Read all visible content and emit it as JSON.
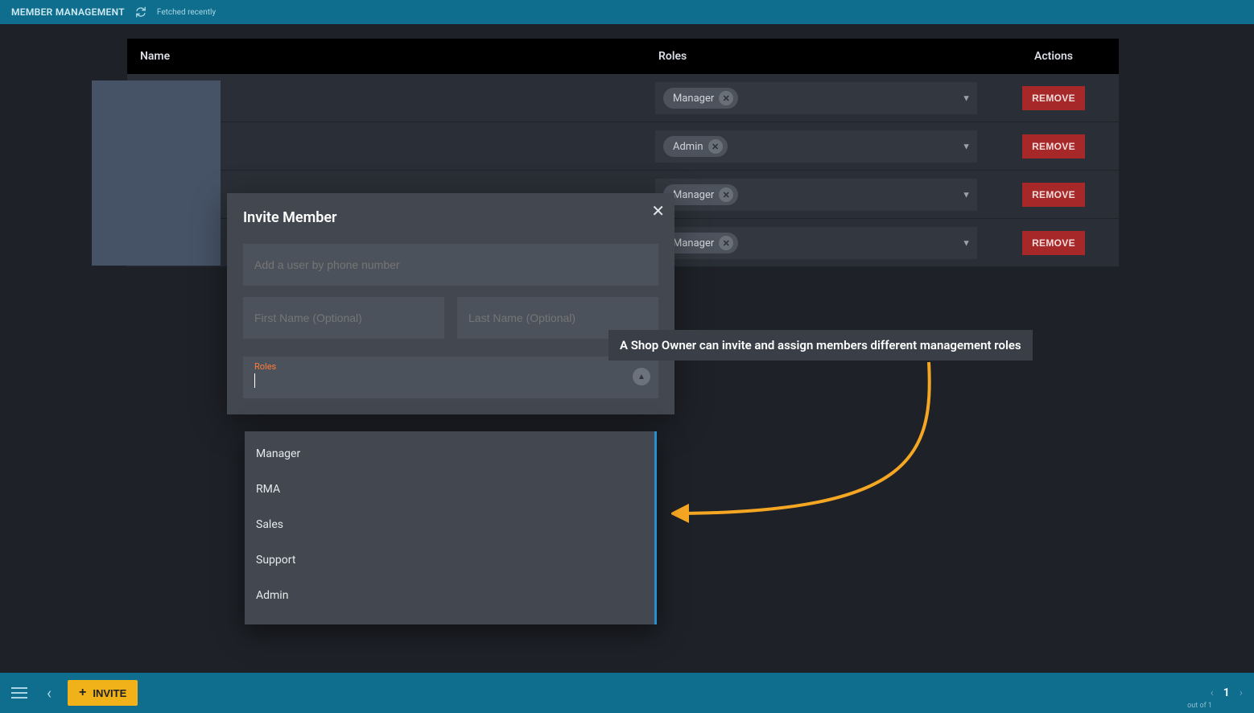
{
  "header": {
    "title": "MEMBER MANAGEMENT",
    "fetched_label": "Fetched recently",
    "refresh_icon": "refresh-icon"
  },
  "table": {
    "columns": {
      "name": "Name",
      "roles": "Roles",
      "actions": "Actions"
    },
    "rows": [
      {
        "role": "Manager",
        "remove_label": "REMOVE"
      },
      {
        "role": "Admin",
        "remove_label": "REMOVE"
      },
      {
        "role": "Manager",
        "remove_label": "REMOVE"
      },
      {
        "role": "Manager",
        "remove_label": "REMOVE"
      }
    ]
  },
  "modal": {
    "title": "Invite Member",
    "phone_placeholder": "Add a user by phone number",
    "first_name_placeholder": "First Name (Optional)",
    "last_name_placeholder": "Last Name (Optional)",
    "roles_label": "Roles",
    "options": [
      "Manager",
      "RMA",
      "Sales",
      "Support",
      "Admin"
    ]
  },
  "annotation": "A Shop Owner can invite and assign members different management roles",
  "footer": {
    "invite_label": "INVITE",
    "page_num": "1",
    "page_total": "out of 1"
  },
  "colors": {
    "top_bar": "#0f6d8d",
    "accent": "#f0b119",
    "danger": "#a62828",
    "highlight": "#ff7b3a"
  }
}
